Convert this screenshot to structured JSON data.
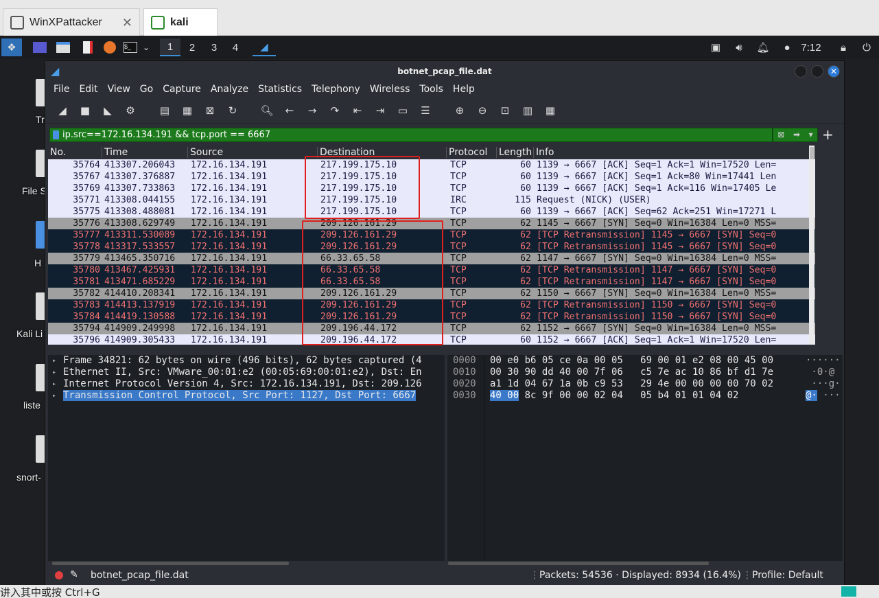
{
  "host": {
    "tabs": [
      {
        "label": "WinXPattacker"
      },
      {
        "label": "kali"
      }
    ],
    "hint": "讲入其中或按 Ctrl+G"
  },
  "kali_panel": {
    "workspaces": [
      "1",
      "2",
      "3",
      "4"
    ],
    "time": "7:12"
  },
  "desktop": {
    "labels": [
      "Tr",
      "File S",
      "H",
      "Kali Li",
      "liste",
      "snort-"
    ]
  },
  "window": {
    "title": "botnet_pcap_file.dat",
    "menu": [
      "File",
      "Edit",
      "View",
      "Go",
      "Capture",
      "Analyze",
      "Statistics",
      "Telephony",
      "Wireless",
      "Tools",
      "Help"
    ],
    "filter": "ip.src==172.16.134.191 && tcp.port == 6667"
  },
  "packet_list": {
    "columns": [
      "No.",
      "Time",
      "Source",
      "Destination",
      "Protocol",
      "Length",
      "Info"
    ],
    "rows": [
      {
        "no": "35764",
        "time": "413307.206043",
        "src": "172.16.134.191",
        "dst": "217.199.175.10",
        "proto": "TCP",
        "len": "60",
        "info": "1139 → 6667 [ACK] Seq=1 Ack=1 Win=17520 Len=",
        "style": "ack"
      },
      {
        "no": "35767",
        "time": "413307.376887",
        "src": "172.16.134.191",
        "dst": "217.199.175.10",
        "proto": "TCP",
        "len": "60",
        "info": "1139 → 6667 [ACK] Seq=1 Ack=80 Win=17441 Len",
        "style": "ack"
      },
      {
        "no": "35769",
        "time": "413307.733863",
        "src": "172.16.134.191",
        "dst": "217.199.175.10",
        "proto": "TCP",
        "len": "60",
        "info": "1139 → 6667 [ACK] Seq=1 Ack=116 Win=17405 Le",
        "style": "ack"
      },
      {
        "no": "35771",
        "time": "413308.044155",
        "src": "172.16.134.191",
        "dst": "217.199.175.10",
        "proto": "IRC",
        "len": "115",
        "info": "Request (NICK) (USER)",
        "style": "ack"
      },
      {
        "no": "35775",
        "time": "413308.488081",
        "src": "172.16.134.191",
        "dst": "217.199.175.10",
        "proto": "TCP",
        "len": "60",
        "info": "1139 → 6667 [ACK] Seq=62 Ack=251 Win=17271 L",
        "style": "ack"
      },
      {
        "no": "35776",
        "time": "413308.629749",
        "src": "172.16.134.191",
        "dst": "209.126.161.29",
        "proto": "TCP",
        "len": "62",
        "info": "1145 → 6667 [SYN] Seq=0 Win=16384 Len=0 MSS=",
        "style": "syn"
      },
      {
        "no": "35777",
        "time": "413311.530089",
        "src": "172.16.134.191",
        "dst": "209.126.161.29",
        "proto": "TCP",
        "len": "62",
        "info": "[TCP Retransmission] 1145 → 6667 [SYN] Seq=0",
        "style": "retx"
      },
      {
        "no": "35778",
        "time": "413317.533557",
        "src": "172.16.134.191",
        "dst": "209.126.161.29",
        "proto": "TCP",
        "len": "62",
        "info": "[TCP Retransmission] 1145 → 6667 [SYN] Seq=0",
        "style": "retx"
      },
      {
        "no": "35779",
        "time": "413465.350716",
        "src": "172.16.134.191",
        "dst": "66.33.65.58",
        "proto": "TCP",
        "len": "62",
        "info": "1147 → 6667 [SYN] Seq=0 Win=16384 Len=0 MSS=",
        "style": "syn"
      },
      {
        "no": "35780",
        "time": "413467.425931",
        "src": "172.16.134.191",
        "dst": "66.33.65.58",
        "proto": "TCP",
        "len": "62",
        "info": "[TCP Retransmission] 1147 → 6667 [SYN] Seq=0",
        "style": "retx"
      },
      {
        "no": "35781",
        "time": "413471.685229",
        "src": "172.16.134.191",
        "dst": "66.33.65.58",
        "proto": "TCP",
        "len": "62",
        "info": "[TCP Retransmission] 1147 → 6667 [SYN] Seq=0",
        "style": "retx"
      },
      {
        "no": "35782",
        "time": "414410.208341",
        "src": "172.16.134.191",
        "dst": "209.126.161.29",
        "proto": "TCP",
        "len": "62",
        "info": "1150 → 6667 [SYN] Seq=0 Win=16384 Len=0 MSS=",
        "style": "syn"
      },
      {
        "no": "35783",
        "time": "414413.137919",
        "src": "172.16.134.191",
        "dst": "209.126.161.29",
        "proto": "TCP",
        "len": "62",
        "info": "[TCP Retransmission] 1150 → 6667 [SYN] Seq=0",
        "style": "retx"
      },
      {
        "no": "35784",
        "time": "414419.130588",
        "src": "172.16.134.191",
        "dst": "209.126.161.29",
        "proto": "TCP",
        "len": "62",
        "info": "[TCP Retransmission] 1150 → 6667 [SYN] Seq=0",
        "style": "retx"
      },
      {
        "no": "35794",
        "time": "414909.249998",
        "src": "172.16.134.191",
        "dst": "209.196.44.172",
        "proto": "TCP",
        "len": "62",
        "info": "1152 → 6667 [SYN] Seq=0 Win=16384 Len=0 MSS=",
        "style": "syn"
      },
      {
        "no": "35796",
        "time": "414909.305433",
        "src": "172.16.134.191",
        "dst": "209.196.44.172",
        "proto": "TCP",
        "len": "60",
        "info": "1152 → 6667 [ACK] Seq=1 Ack=1 Win=17520 Len=",
        "style": "ack"
      }
    ]
  },
  "details": [
    {
      "text": "Frame 34821: 62 bytes on wire (496 bits), 62 bytes captured (4",
      "selected": false
    },
    {
      "text": "Ethernet II, Src: VMware_00:01:e2 (00:05:69:00:01:e2), Dst: En",
      "selected": false
    },
    {
      "text": "Internet Protocol Version 4, Src: 172.16.134.191, Dst: 209.126",
      "selected": false
    },
    {
      "text": "Transmission Control Protocol, Src Port: 1127, Dst Port: 6667",
      "selected": true
    }
  ],
  "bytes": {
    "offsets": [
      "0000",
      "0010",
      "0020",
      "0030"
    ],
    "hex": [
      "00 e0 b6 05 ce 0a 00 05   69 00 01 e2 08 00 45 00",
      "00 30 90 dd 40 00 7f 06   c5 7e ac 10 86 bf d1 7e",
      "a1 1d 04 67 1a 0b c9 53   29 4e 00 00 00 00 70 02",
      " 8c 9f 00 00 02 04   05 b4 01 01 04 02"
    ],
    "hex_highlight": "40 00",
    "ascii": [
      "······",
      " ·0·@",
      " ···g·",
      " ···"
    ],
    "ascii_highlight": "@·"
  },
  "status": {
    "file": "botnet_pcap_file.dat",
    "packets": "Packets: 54536 · Displayed: 8934 (16.4%)",
    "profile": "Profile: Default"
  },
  "colors": {
    "filter_bg": "#1c7a1c",
    "ack_bg": "#e8e9fb",
    "syn_bg": "#a0a0a0",
    "retx_bg": "#102030",
    "retx_fg": "#f07070",
    "annotation": "#e0201c"
  }
}
